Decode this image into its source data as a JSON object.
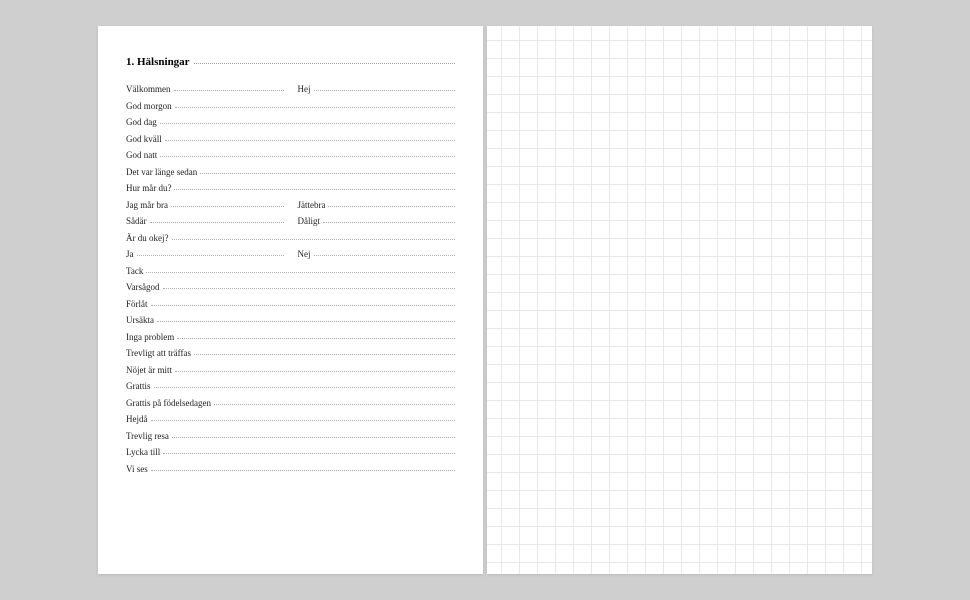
{
  "heading": "1. Hälsningar",
  "rows": [
    {
      "type": "pair",
      "a": "Välkommen",
      "b": "Hej"
    },
    {
      "type": "single",
      "a": "God morgon"
    },
    {
      "type": "single",
      "a": "God dag"
    },
    {
      "type": "single",
      "a": "God kväll"
    },
    {
      "type": "single",
      "a": "God natt"
    },
    {
      "type": "single",
      "a": "Det var länge sedan"
    },
    {
      "type": "single",
      "a": "Hur mår du?"
    },
    {
      "type": "pair",
      "a": "Jag mår bra",
      "b": "Jättebra"
    },
    {
      "type": "pair",
      "a": "Sådär",
      "b": "Dåligt"
    },
    {
      "type": "single",
      "a": "Är du okej?"
    },
    {
      "type": "pair",
      "a": "Ja",
      "b": "Nej"
    },
    {
      "type": "single",
      "a": "Tack"
    },
    {
      "type": "single",
      "a": "Varsågod"
    },
    {
      "type": "single",
      "a": "Förlåt"
    },
    {
      "type": "single",
      "a": "Ursäkta"
    },
    {
      "type": "single",
      "a": "Inga problem"
    },
    {
      "type": "single",
      "a": "Trevligt att träffas"
    },
    {
      "type": "single",
      "a": "Nöjet är mitt"
    },
    {
      "type": "single",
      "a": "Grattis"
    },
    {
      "type": "single",
      "a": "Grattis på födelsedagen"
    },
    {
      "type": "single",
      "a": "Hejdå"
    },
    {
      "type": "single",
      "a": "Trevlig resa"
    },
    {
      "type": "single",
      "a": "Lycka till"
    },
    {
      "type": "single",
      "a": "Vi ses"
    }
  ]
}
